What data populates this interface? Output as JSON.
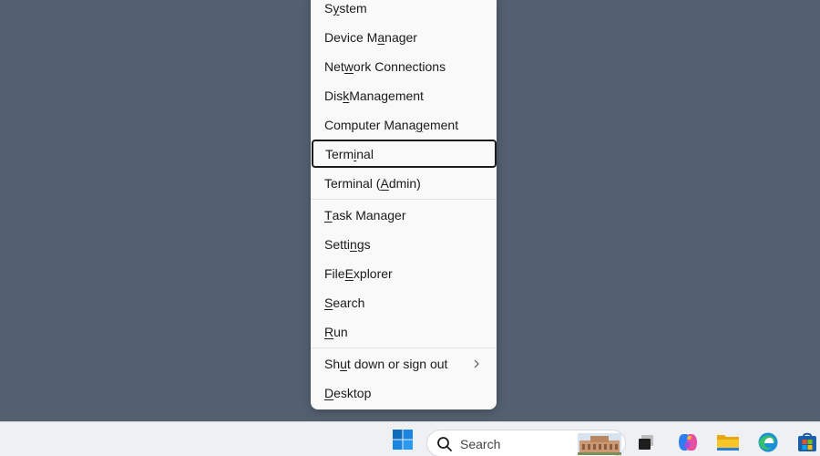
{
  "menu": {
    "items": [
      {
        "label": "System",
        "pre": "S",
        "u": "y",
        "post": "stem"
      },
      {
        "label": "Device Manager",
        "pre": "Device M",
        "u": "a",
        "post": "nager"
      },
      {
        "label": "Network Connections",
        "pre": "Net",
        "u": "w",
        "post": "ork Connections"
      },
      {
        "label": "Disk Management",
        "pre": "Dis",
        "u": "k",
        "post": " Management"
      },
      {
        "label": "Computer Management",
        "pre": "Computer Mana",
        "u": "g",
        "post": "ement"
      },
      {
        "label": "Terminal",
        "pre": "Term",
        "u": "i",
        "post": "nal"
      },
      {
        "label": "Terminal (Admin)",
        "pre": "Terminal (",
        "u": "A",
        "post": "dmin)"
      },
      {
        "label": "Task Manager",
        "pre": "",
        "u": "T",
        "post": "ask Manager"
      },
      {
        "label": "Settings",
        "pre": "Setti",
        "u": "n",
        "post": "gs"
      },
      {
        "label": "File Explorer",
        "pre": "File ",
        "u": "E",
        "post": "xplorer"
      },
      {
        "label": "Search",
        "pre": "",
        "u": "S",
        "post": "earch"
      },
      {
        "label": "Run",
        "pre": "",
        "u": "R",
        "post": "un"
      },
      {
        "label": "Shut down or sign out",
        "pre": "Sh",
        "u": "u",
        "post": "t down or sign out"
      },
      {
        "label": "Desktop",
        "pre": "",
        "u": "D",
        "post": "esktop"
      }
    ],
    "focused_item": "Terminal"
  },
  "taskbar": {
    "search_placeholder": "Search",
    "icons": [
      "windows-start-icon",
      "search-icon",
      "task-view-icon",
      "copilot-icon",
      "file-explorer-icon",
      "edge-icon",
      "microsoft-store-icon"
    ]
  },
  "colors": {
    "desktop": "#536070",
    "menu_bg": "#f9f9f9",
    "taskbar_bg": "#eef0f3",
    "start_blue": "#0f6cbd"
  }
}
